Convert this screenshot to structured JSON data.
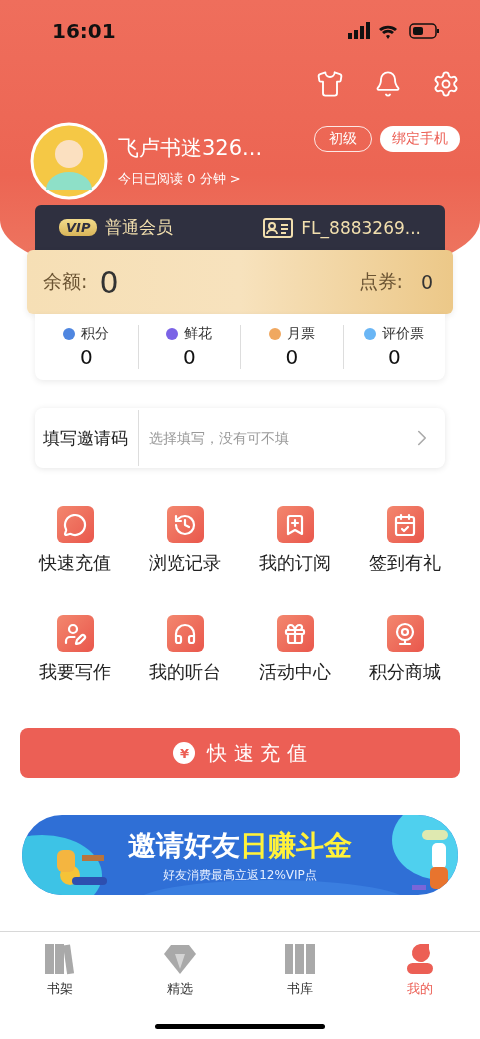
{
  "status_bar": {
    "time": "16:01"
  },
  "profile": {
    "name": "飞卢书迷326...",
    "reading_today": "今日已阅读 0 分钟 >",
    "level_badge": "初级",
    "bind_phone_button": "绑定手机"
  },
  "membership": {
    "vip_badge": "VIP",
    "tier": "普通会员",
    "user_id": "FL_8883269..."
  },
  "balance": {
    "label": "余额:",
    "value": "0",
    "coupons_label": "点券:",
    "coupons_value": "0"
  },
  "stats": [
    {
      "label": "积分",
      "value": "0",
      "color": "#4f86e0"
    },
    {
      "label": "鲜花",
      "value": "0",
      "color": "#7b63e6"
    },
    {
      "label": "月票",
      "value": "0",
      "color": "#f0a860"
    },
    {
      "label": "评价票",
      "value": "0",
      "color": "#6ab6f5"
    }
  ],
  "invite": {
    "label": "填写邀请码",
    "placeholder": "选择填写，没有可不填"
  },
  "shortcuts": [
    {
      "label": "快速充值"
    },
    {
      "label": "浏览记录"
    },
    {
      "label": "我的订阅"
    },
    {
      "label": "签到有礼"
    },
    {
      "label": "我要写作"
    },
    {
      "label": "我的听台"
    },
    {
      "label": "活动中心"
    },
    {
      "label": "积分商城"
    }
  ],
  "recharge_button": {
    "icon": "¥",
    "label": "快 速 充 值"
  },
  "banner": {
    "headline": "邀请好友",
    "headline_highlight": "日赚斗金",
    "subline": "好友消费最高立返12%VIP点"
  },
  "tab_bar": [
    {
      "label": "书架",
      "selected": false
    },
    {
      "label": "精选",
      "selected": false
    },
    {
      "label": "书库",
      "selected": false
    },
    {
      "label": "我的",
      "selected": true
    }
  ]
}
